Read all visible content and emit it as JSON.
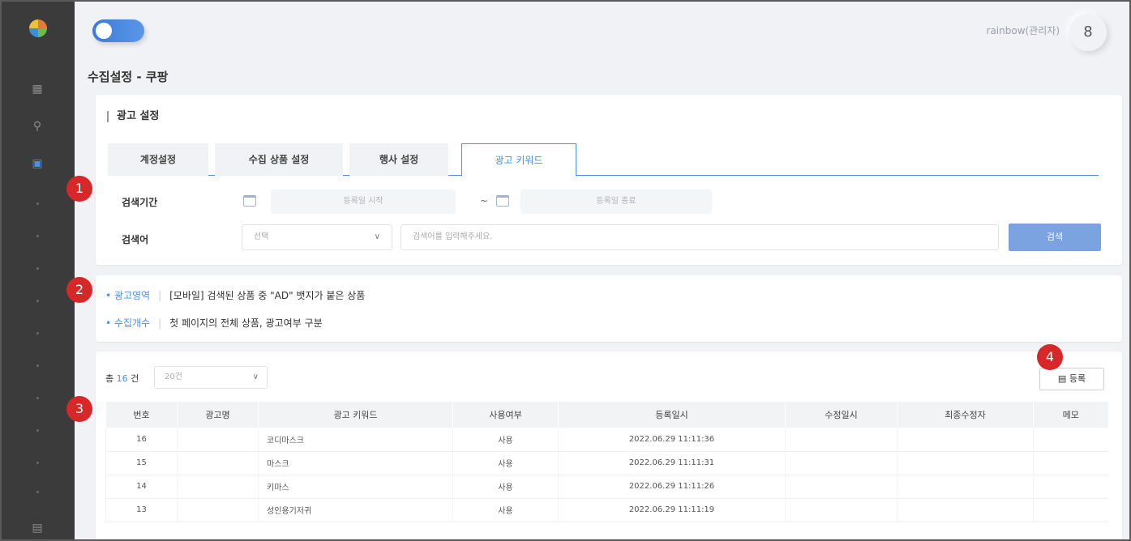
{
  "sidebar": {
    "icons": [
      "logo-icon",
      "chart-icon",
      "search-icon",
      "chat-icon",
      "document-icon"
    ]
  },
  "header": {
    "user_label": "rainbow(관리자)",
    "avatar_glyph": "8"
  },
  "page": {
    "title": "수집설정 - 쿠팡"
  },
  "settings": {
    "section_title": "광고 설정",
    "tabs": [
      {
        "label": "계정설정"
      },
      {
        "label": "수집 상품 설정"
      },
      {
        "label": "행사 설정"
      },
      {
        "label": "광고 키워드",
        "active": true
      }
    ],
    "period_label": "검색기간",
    "start_placeholder": "등록일 시작",
    "range_sep": "~",
    "end_placeholder": "등록일 종료",
    "keyword_label": "검색어",
    "select_value": "선택",
    "search_placeholder": "검색어를 입력해주세요.",
    "search_button": "검색"
  },
  "info": {
    "line1_key": "광고영역",
    "line1_val": "[모바일] 검색된 상품 중 \"AD\" 뱃지가 붙은 상품",
    "line2_key": "수집개수",
    "line2_val": "첫 페이지의 전체 상품, 광고여부 구분"
  },
  "list": {
    "total_prefix": "총",
    "total_count": "16",
    "total_suffix": "건",
    "page_size": "20건",
    "register_button": "등록",
    "columns": [
      "번호",
      "광고명",
      "광고 키워드",
      "사용여부",
      "등록일시",
      "수정일시",
      "최종수정자",
      "메모"
    ],
    "rows": [
      {
        "no": "16",
        "name": "",
        "keyword": "코디마스크",
        "use": "사용",
        "created": "2022.06.29 11:11:36",
        "modified": "",
        "editor": "",
        "memo": ""
      },
      {
        "no": "15",
        "name": "",
        "keyword": "마스크",
        "use": "사용",
        "created": "2022.06.29 11:11:31",
        "modified": "",
        "editor": "",
        "memo": ""
      },
      {
        "no": "14",
        "name": "",
        "keyword": "키마스",
        "use": "사용",
        "created": "2022.06.29 11:11:26",
        "modified": "",
        "editor": "",
        "memo": ""
      },
      {
        "no": "13",
        "name": "",
        "keyword": "성인용기저귀",
        "use": "사용",
        "created": "2022.06.29 11:11:19",
        "modified": "",
        "editor": "",
        "memo": ""
      }
    ]
  },
  "annotations": [
    "1",
    "2",
    "3",
    "4"
  ],
  "colors": {
    "accent": "#4a90e2",
    "sidebar": "#3b3b3b",
    "badge": "#d62828"
  }
}
